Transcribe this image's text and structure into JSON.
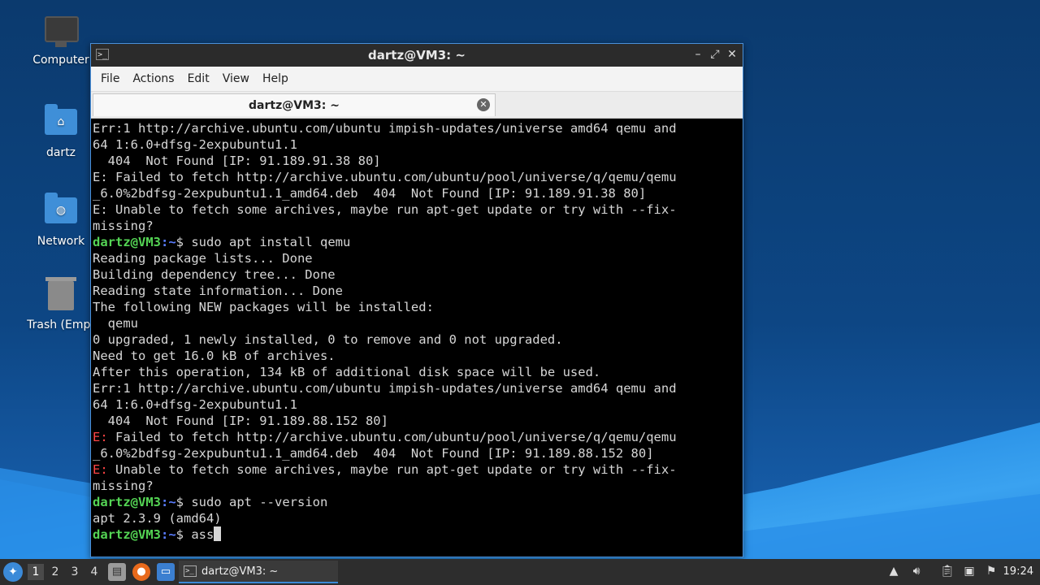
{
  "desktop": {
    "icons": [
      {
        "label": "Computer",
        "icon": "computer-icon"
      },
      {
        "label": "dartz",
        "icon": "home-folder-icon"
      },
      {
        "label": "Network",
        "icon": "network-folder-icon"
      },
      {
        "label": "Trash (Empt",
        "icon": "trash-icon"
      }
    ]
  },
  "window": {
    "title": "dartz@VM3: ~",
    "menu": [
      "File",
      "Actions",
      "Edit",
      "View",
      "Help"
    ],
    "tab_label": "dartz@VM3: ~"
  },
  "terminal": {
    "prompt_user": "dartz@VM3",
    "prompt_path": ":~",
    "prompt_symbol": "$ ",
    "lines": [
      {
        "t": "Err:1 http://archive.ubuntu.com/ubuntu impish-updates/universe amd64 qemu and"
      },
      {
        "t": "64 1:6.0+dfsg-2expubuntu1.1"
      },
      {
        "t": "  404  Not Found [IP: 91.189.91.38 80]"
      },
      {
        "t": "E: Failed to fetch http://archive.ubuntu.com/ubuntu/pool/universe/q/qemu/qemu"
      },
      {
        "t": "_6.0%2bdfsg-2expubuntu1.1_amd64.deb  404  Not Found [IP: 91.189.91.38 80]"
      },
      {
        "t": "E: Unable to fetch some archives, maybe run apt-get update or try with --fix-"
      },
      {
        "t": "missing?"
      },
      {
        "cmd": "sudo apt install qemu"
      },
      {
        "t": "Reading package lists... Done"
      },
      {
        "t": "Building dependency tree... Done"
      },
      {
        "t": "Reading state information... Done"
      },
      {
        "t": "The following NEW packages will be installed:"
      },
      {
        "t": "  qemu"
      },
      {
        "t": "0 upgraded, 1 newly installed, 0 to remove and 0 not upgraded."
      },
      {
        "t": "Need to get 16.0 kB of archives."
      },
      {
        "t": "After this operation, 134 kB of additional disk space will be used."
      },
      {
        "t": "Err:1 http://archive.ubuntu.com/ubuntu impish-updates/universe amd64 qemu and"
      },
      {
        "t": "64 1:6.0+dfsg-2expubuntu1.1"
      },
      {
        "t": "  404  Not Found [IP: 91.189.88.152 80]"
      },
      {
        "e": "E:",
        "t": " Failed to fetch http://archive.ubuntu.com/ubuntu/pool/universe/q/qemu/qemu"
      },
      {
        "t": "_6.0%2bdfsg-2expubuntu1.1_amd64.deb  404  Not Found [IP: 91.189.88.152 80]"
      },
      {
        "e": "E:",
        "t": " Unable to fetch some archives, maybe run apt-get update or try with --fix-"
      },
      {
        "t": "missing?"
      },
      {
        "cmd": "sudo apt --version"
      },
      {
        "t": "apt 2.3.9 (amd64)"
      },
      {
        "cmd": "ass",
        "cursor": true
      }
    ]
  },
  "taskbar": {
    "workspaces": [
      "1",
      "2",
      "3",
      "4"
    ],
    "launchers": [
      "file-manager-icon",
      "firefox-icon",
      "desktop-icon"
    ],
    "task_label": "dartz@VM3: ~",
    "tray": [
      "up-arrow-icon",
      "volume-icon",
      "clipboard-icon",
      "network-display-icon",
      "notification-icon"
    ],
    "clock": "19:24"
  },
  "colors": {
    "prompt_user": "#54d454",
    "prompt_path": "#5a7dff",
    "error": "#ff4444",
    "accent": "#3b8ad8"
  }
}
